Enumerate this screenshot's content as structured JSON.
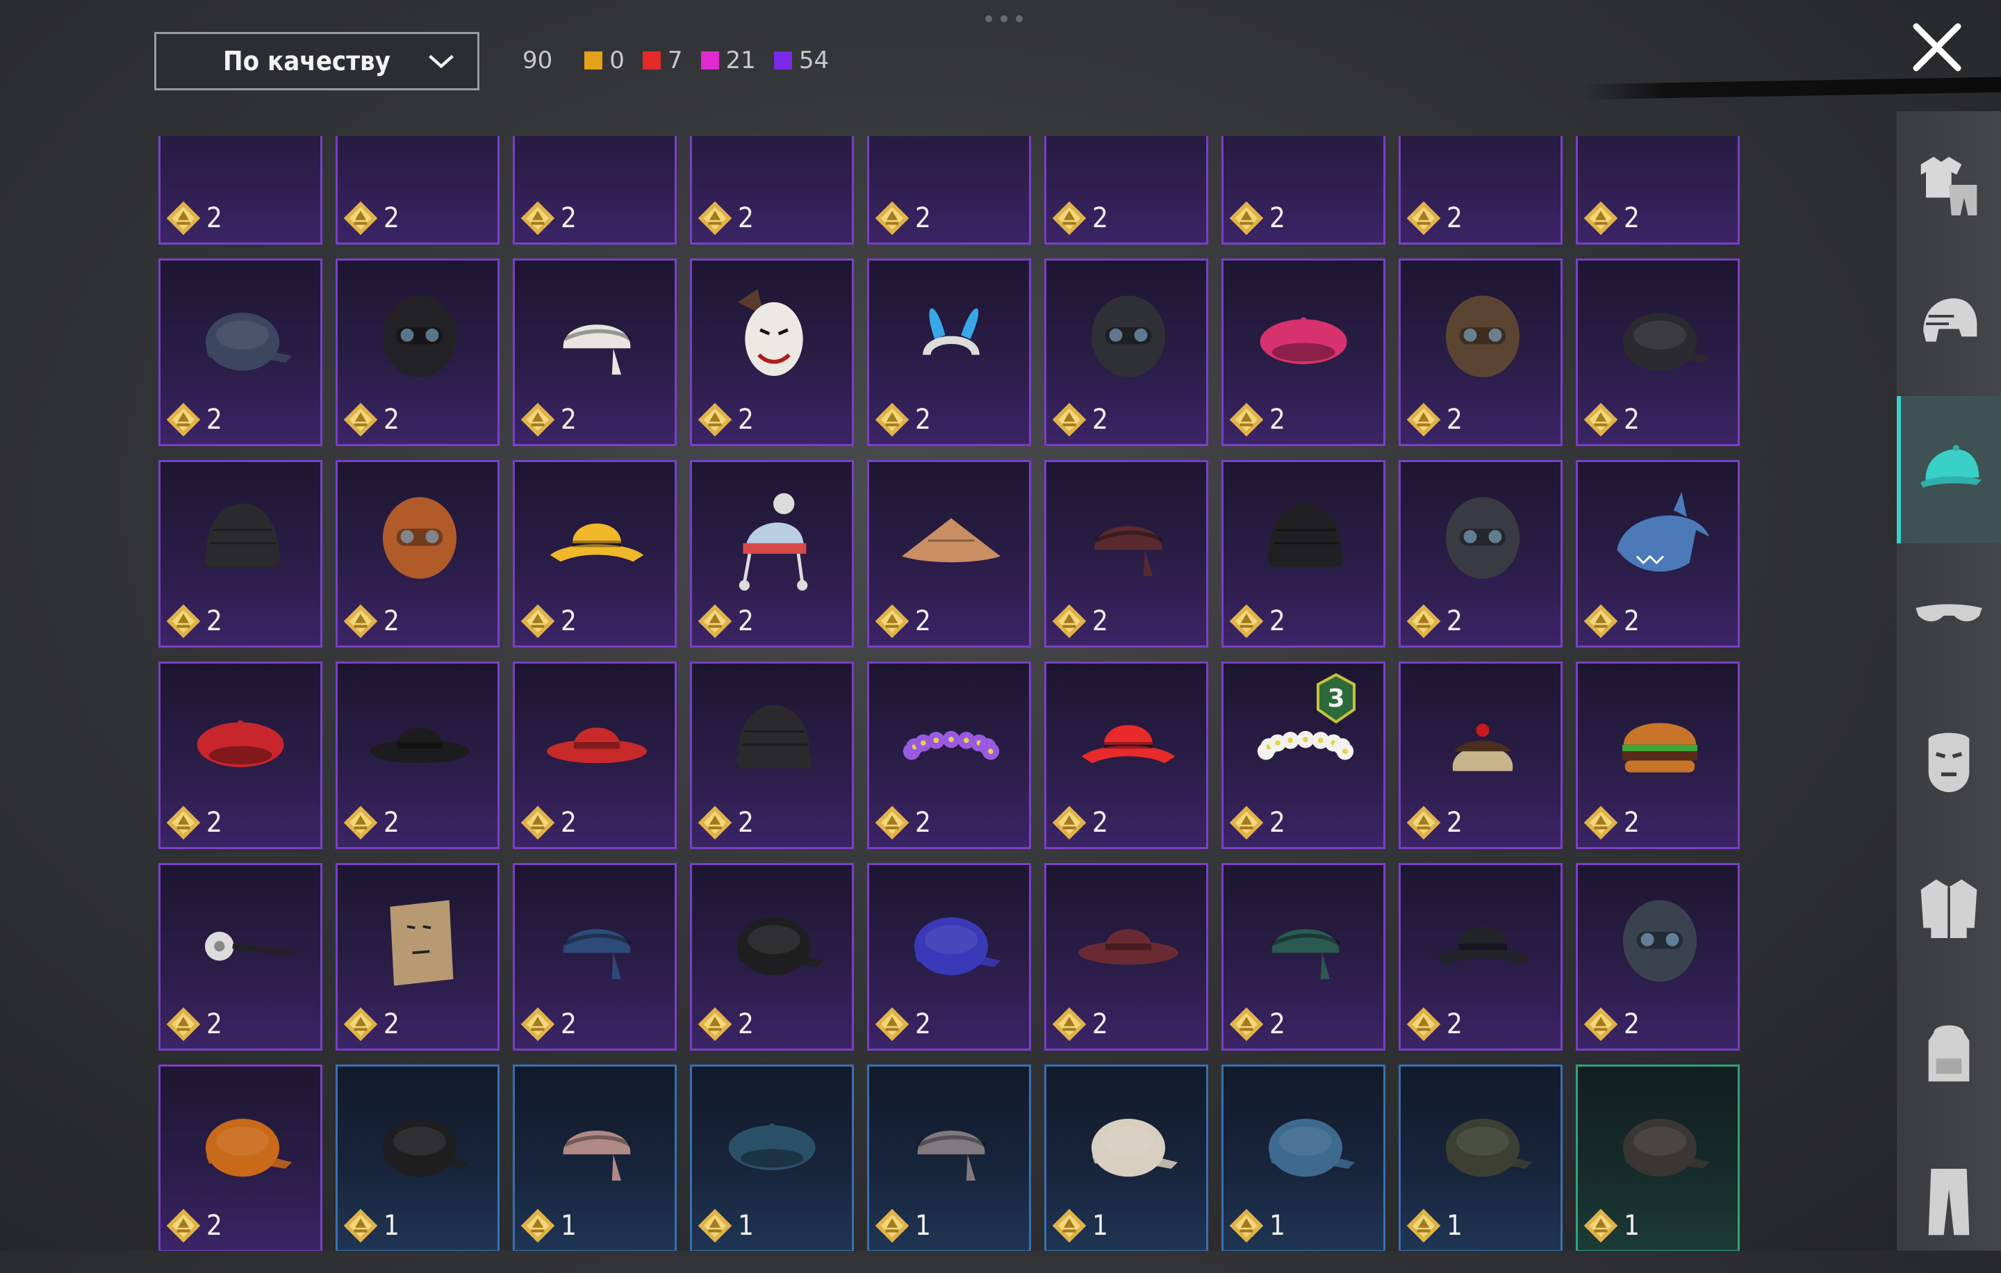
{
  "toolbar": {
    "sort_label": "По качеству",
    "total": "90",
    "counts": [
      {
        "color": "#e3a219",
        "value": "0"
      },
      {
        "color": "#e52a2a",
        "value": "7"
      },
      {
        "color": "#e02ad0",
        "value": "21"
      },
      {
        "color": "#7a2ae6",
        "value": "54"
      }
    ]
  },
  "sidebar": {
    "categories": [
      "outfit",
      "helmet",
      "hat",
      "glasses",
      "mask",
      "jacket",
      "backpack",
      "pants"
    ],
    "active": "hat",
    "accent": "#39d0c8"
  },
  "grid": {
    "items": [
      {
        "icon": "hair-item",
        "price": "2",
        "rarity": "purple"
      },
      {
        "icon": "hair-item",
        "price": "2",
        "rarity": "purple"
      },
      {
        "icon": "hair-item",
        "price": "2",
        "rarity": "purple"
      },
      {
        "icon": "hair-item",
        "price": "2",
        "rarity": "purple"
      },
      {
        "icon": "hair-item",
        "price": "2",
        "rarity": "purple"
      },
      {
        "icon": "hair-item",
        "price": "2",
        "rarity": "purple"
      },
      {
        "icon": "hair-item",
        "price": "2",
        "rarity": "purple"
      },
      {
        "icon": "hair-item",
        "price": "2",
        "rarity": "purple"
      },
      {
        "icon": "hair-item",
        "price": "2",
        "rarity": "purple"
      },
      {
        "icon": "baseball-cap",
        "price": "2",
        "rarity": "purple",
        "color": "#3d4660"
      },
      {
        "icon": "gas-mask",
        "price": "2",
        "rarity": "purple",
        "color": "#222226"
      },
      {
        "icon": "turban",
        "price": "2",
        "rarity": "purple",
        "color": "#e8e6e0"
      },
      {
        "icon": "clown-mask",
        "price": "2",
        "rarity": "purple",
        "color": "#ece8e4"
      },
      {
        "icon": "bunny-ears",
        "price": "2",
        "rarity": "purple",
        "color": "#38a8e6"
      },
      {
        "icon": "visor-helmet",
        "price": "2",
        "rarity": "purple",
        "color": "#2f3036"
      },
      {
        "icon": "beret",
        "price": "2",
        "rarity": "purple",
        "color": "#d8326c"
      },
      {
        "icon": "aviator-helmet",
        "price": "2",
        "rarity": "purple",
        "color": "#5b4532"
      },
      {
        "icon": "baseball-cap",
        "price": "2",
        "rarity": "purple",
        "color": "#2a2a30"
      },
      {
        "icon": "beanie",
        "price": "2",
        "rarity": "purple",
        "color": "#2b2b2d"
      },
      {
        "icon": "football-helmet",
        "price": "2",
        "rarity": "purple",
        "color": "#b15a2a"
      },
      {
        "icon": "bucket-hat",
        "price": "2",
        "rarity": "purple",
        "color": "#f0b82a"
      },
      {
        "icon": "pompom-hat",
        "price": "2",
        "rarity": "purple",
        "color": "#b9cde3"
      },
      {
        "icon": "conical-hat",
        "price": "2",
        "rarity": "purple",
        "color": "#c98e64"
      },
      {
        "icon": "bandana",
        "price": "2",
        "rarity": "purple",
        "color": "#5a2a30"
      },
      {
        "icon": "beanie",
        "price": "2",
        "rarity": "purple",
        "color": "#202022"
      },
      {
        "icon": "wrestler-mask",
        "price": "2",
        "rarity": "purple",
        "color": "#3a3b42"
      },
      {
        "icon": "shark-hat",
        "price": "2",
        "rarity": "purple",
        "color": "#4a7ab8"
      },
      {
        "icon": "beret",
        "price": "2",
        "rarity": "purple",
        "color": "#c8262c"
      },
      {
        "icon": "bowler-hat",
        "price": "2",
        "rarity": "purple",
        "color": "#1c1c1e"
      },
      {
        "icon": "fedora",
        "price": "2",
        "rarity": "purple",
        "color": "#c82a2a"
      },
      {
        "icon": "headphone-beanie",
        "price": "2",
        "rarity": "purple",
        "color": "#2a2a2c"
      },
      {
        "icon": "flower-crown",
        "price": "2",
        "rarity": "purple",
        "color": "#9a5ae0"
      },
      {
        "icon": "bucket-hat",
        "price": "2",
        "rarity": "purple",
        "color": "#e82a2a"
      },
      {
        "icon": "flower-crown",
        "price": "2",
        "rarity": "purple",
        "color": "#f2f2ee",
        "badge": "3"
      },
      {
        "icon": "cake-hat",
        "price": "2",
        "rarity": "purple",
        "color": "#c8b48a"
      },
      {
        "icon": "burger-hat",
        "price": "2",
        "rarity": "purple",
        "color": "#c8742a"
      },
      {
        "icon": "head-mirror",
        "price": "2",
        "rarity": "purple",
        "color": "#dcdcdc"
      },
      {
        "icon": "paper-bag",
        "price": "2",
        "rarity": "purple",
        "color": "#b89a72"
      },
      {
        "icon": "pillbox-hat",
        "price": "2",
        "rarity": "purple",
        "color": "#2e4a78"
      },
      {
        "icon": "baseball-cap",
        "price": "2",
        "rarity": "purple",
        "color": "#1e1e20"
      },
      {
        "icon": "baseball-cap",
        "price": "2",
        "rarity": "purple",
        "color": "#3a3ab8"
      },
      {
        "icon": "fedora",
        "price": "2",
        "rarity": "purple",
        "color": "#6a2a34"
      },
      {
        "icon": "bandana",
        "price": "2",
        "rarity": "purple",
        "color": "#2a5a52"
      },
      {
        "icon": "bucket-hat",
        "price": "2",
        "rarity": "purple",
        "color": "#22242a"
      },
      {
        "icon": "aviator-helmet",
        "price": "2",
        "rarity": "purple",
        "color": "#3a4250"
      },
      {
        "icon": "baseball-cap",
        "price": "2",
        "rarity": "purple",
        "color": "#c86a1a"
      },
      {
        "icon": "baseball-cap",
        "price": "1",
        "rarity": "blue",
        "color": "#1e1e20"
      },
      {
        "icon": "bandana",
        "price": "1",
        "rarity": "blue",
        "color": "#b08a86"
      },
      {
        "icon": "beret",
        "price": "1",
        "rarity": "blue",
        "color": "#2a5068"
      },
      {
        "icon": "flat-cap",
        "price": "1",
        "rarity": "blue",
        "color": "#807a7e"
      },
      {
        "icon": "baseball-cap",
        "price": "1",
        "rarity": "blue",
        "color": "#d8cfc0"
      },
      {
        "icon": "baseball-cap",
        "price": "1",
        "rarity": "blue",
        "color": "#3e6a90"
      },
      {
        "icon": "headset-cap",
        "price": "1",
        "rarity": "blue",
        "color": "#3c4032"
      },
      {
        "icon": "patrol-cap",
        "price": "1",
        "rarity": "green",
        "color": "#3a3634"
      }
    ]
  }
}
